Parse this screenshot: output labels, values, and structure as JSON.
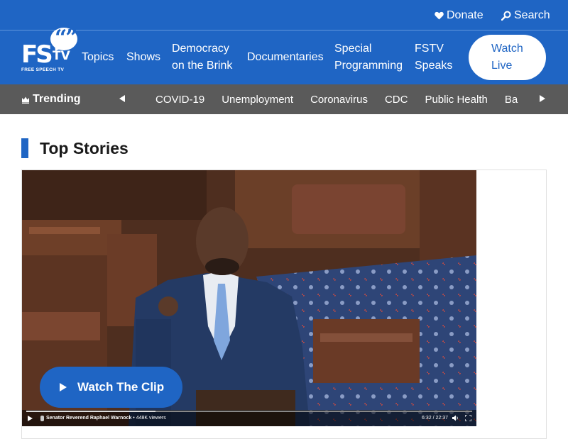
{
  "utility": {
    "donate_label": "Donate",
    "search_label": "Search"
  },
  "logo": {
    "letters": "FS",
    "tv": "TV",
    "quote": "“”",
    "tagline": "FREE SPEECH TV"
  },
  "nav": {
    "topics": "Topics",
    "shows": "Shows",
    "democracy": "Democracy on the Brink",
    "documentaries": "Documentaries",
    "special": "Special Programming",
    "fstv_speaks": "FSTV Speaks",
    "watch_live": "Watch Live"
  },
  "trending": {
    "label": "Trending",
    "tags": [
      "COVID-19",
      "Unemployment",
      "Coronavirus",
      "CDC",
      "Public Health",
      "Ba"
    ]
  },
  "main": {
    "section_title": "Top Stories",
    "watch_clip_label": "Watch The Clip",
    "video": {
      "caption_name": "Senator Reverend Raphael Warnock",
      "caption_views": "• 448K viewers",
      "time": "6:32 / 22:37",
      "progress": 0.29
    }
  },
  "colors": {
    "brand_blue": "#1f65c4",
    "trending_bg": "#5a5a5a"
  },
  "icons": [
    "heart-icon",
    "search-icon",
    "crown-icon",
    "arrow-left-icon",
    "arrow-right-icon",
    "play-icon",
    "volume-icon",
    "fullscreen-icon"
  ]
}
